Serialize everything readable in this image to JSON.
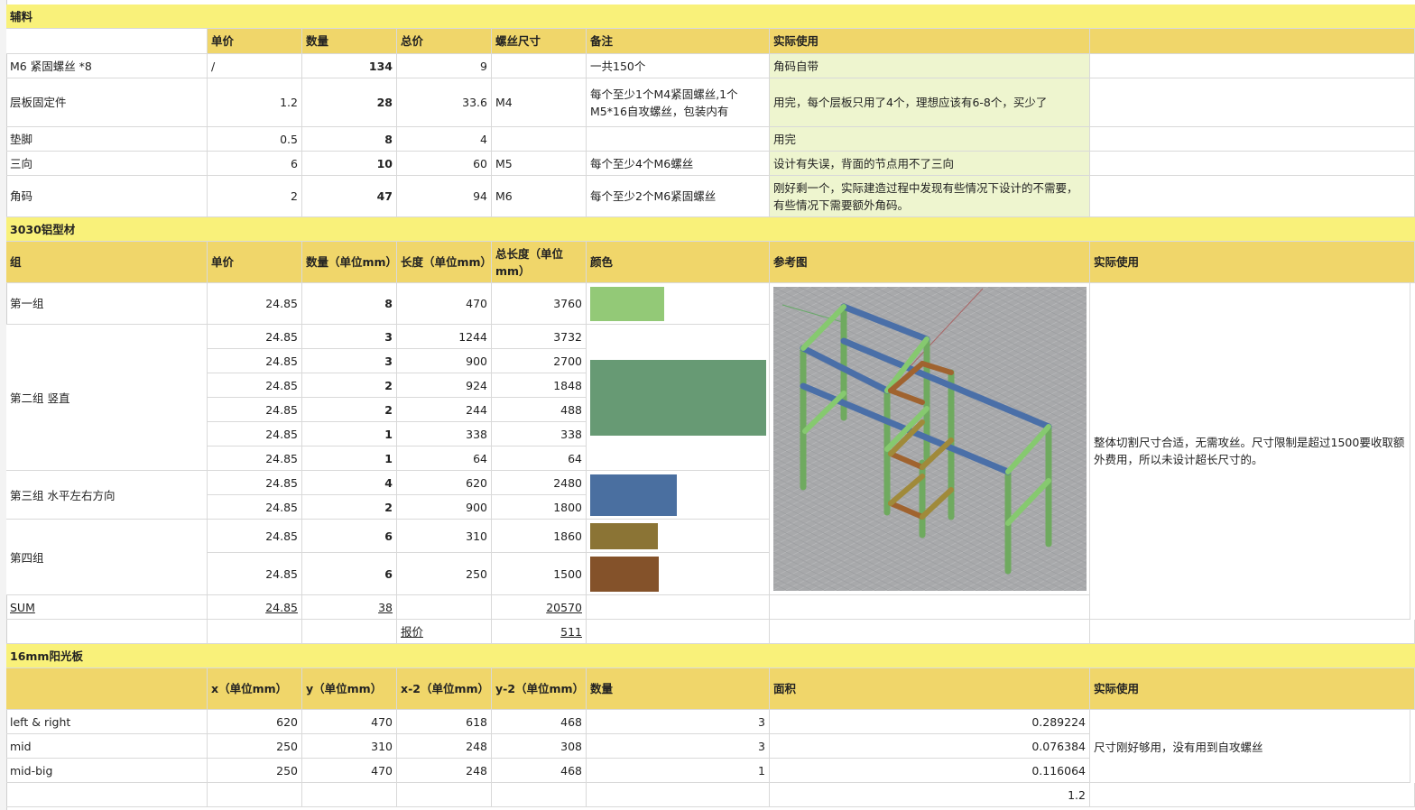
{
  "sections": {
    "fasteners": {
      "title": "辅料",
      "headers": [
        "",
        "单价",
        "数量",
        "总价",
        "螺丝尺寸",
        "备注",
        "实际使用",
        ""
      ],
      "rows": [
        {
          "name": "M6 紧固螺丝 *8",
          "price": "/",
          "qty": "134",
          "total": "9",
          "size": "",
          "note": "一共150个",
          "usage": "角码自带"
        },
        {
          "name": "层板固定件",
          "price": "1.2",
          "qty": "28",
          "total": "33.6",
          "size": "M4",
          "note": "每个至少1个M4紧固螺丝,1个M5*16自攻螺丝，包装内有",
          "usage": "用完，每个层板只用了4个，理想应该有6-8个，买少了"
        },
        {
          "name": "垫脚",
          "price": "0.5",
          "qty": "8",
          "total": "4",
          "size": "",
          "note": "",
          "usage": "用完"
        },
        {
          "name": "三向",
          "price": "6",
          "qty": "10",
          "total": "60",
          "size": "M5",
          "note": "每个至少4个M6螺丝",
          "usage": "设计有失误，背面的节点用不了三向"
        },
        {
          "name": "角码",
          "price": "2",
          "qty": "47",
          "total": "94",
          "size": "M6",
          "note": "每个至少2个M6紧固螺丝",
          "usage": "刚好剩一个，实际建造过程中发现有些情况下设计的不需要，有些情况下需要额外角码。"
        }
      ]
    },
    "profiles": {
      "title": "3030铝型材",
      "headers": [
        "组",
        "单价",
        "数量（单位mm）",
        "长度（单位mm）",
        "总长度（单位mm）",
        "颜色",
        "参考图",
        "实际使用"
      ],
      "groups": [
        {
          "name": "第一组",
          "rows": [
            {
              "price": "24.85",
              "qty": "8",
              "len": "470",
              "total": "3760"
            }
          ]
        },
        {
          "name": "第二组 竖直",
          "rows": [
            {
              "price": "24.85",
              "qty": "3",
              "len": "1244",
              "total": "3732"
            },
            {
              "price": "24.85",
              "qty": "3",
              "len": "900",
              "total": "2700"
            },
            {
              "price": "24.85",
              "qty": "2",
              "len": "924",
              "total": "1848"
            },
            {
              "price": "24.85",
              "qty": "2",
              "len": "244",
              "total": "488"
            },
            {
              "price": "24.85",
              "qty": "1",
              "len": "338",
              "total": "338"
            },
            {
              "price": "24.85",
              "qty": "1",
              "len": "64",
              "total": "64"
            }
          ]
        },
        {
          "name": "第三组 水平左右方向",
          "rows": [
            {
              "price": "24.85",
              "qty": "4",
              "len": "620",
              "total": "2480"
            },
            {
              "price": "24.85",
              "qty": "2",
              "len": "900",
              "total": "1800"
            }
          ]
        },
        {
          "name": "第四组",
          "rows": [
            {
              "price": "24.85",
              "qty": "6",
              "len": "310",
              "total": "1860"
            },
            {
              "price": "24.85",
              "qty": "6",
              "len": "250",
              "total": "1500"
            }
          ]
        }
      ],
      "sum": {
        "label": "SUM",
        "price": "24.85",
        "qty": "38",
        "total": "20570"
      },
      "quote": {
        "label": "报价",
        "value": "511"
      },
      "usage": "整体切割尺寸合适，无需攻丝。尺寸限制是超过1500要收取额外费用，所以未设计超长尺寸的。",
      "colors": {
        "group1": "#93c977",
        "group2": "#679a74",
        "group3": "#4a6fa0",
        "group4a": "#8b7435",
        "group4b": "#84522a"
      }
    },
    "panels": {
      "title": "16mm阳光板",
      "headers": [
        "",
        "x（单位mm）",
        "y（单位mm）",
        "x-2（单位mm）",
        "y-2（单位mm）",
        "数量",
        "面积",
        "实际使用"
      ],
      "rows": [
        {
          "name": "left & right",
          "x": "620",
          "y": "470",
          "x2": "618",
          "y2": "468",
          "qty": "3",
          "area": "0.289224"
        },
        {
          "name": "mid",
          "x": "250",
          "y": "310",
          "x2": "248",
          "y2": "308",
          "qty": "3",
          "area": "0.076384"
        },
        {
          "name": "mid-big",
          "x": "250",
          "y": "470",
          "x2": "248",
          "y2": "468",
          "qty": "1",
          "area": "0.116064"
        }
      ],
      "total_area": "1.2",
      "usage": "尺寸刚好够用，没有用到自攻螺丝"
    }
  },
  "colors": {
    "section_bg": "#f9f17a",
    "header_bg": "#f0d66a",
    "note_bg": "#eef5cf"
  }
}
